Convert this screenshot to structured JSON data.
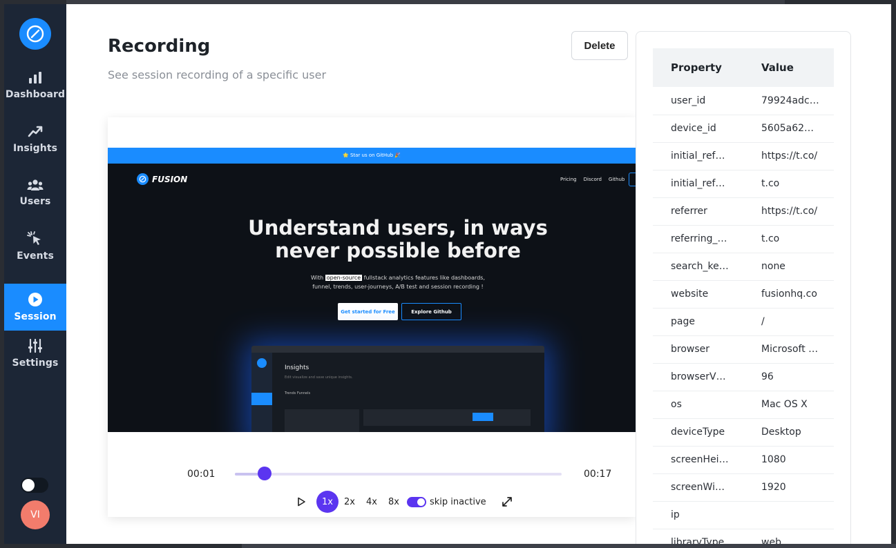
{
  "sidebar": {
    "items": [
      {
        "label": "Dashboard",
        "icon": "bar-chart-icon"
      },
      {
        "label": "Insights",
        "icon": "trend-up-icon"
      },
      {
        "label": "Users",
        "icon": "users-icon"
      },
      {
        "label": "Events",
        "icon": "cursor-click-icon"
      },
      {
        "label": "Session",
        "icon": "play-circle-icon",
        "active": true
      },
      {
        "label": "Settings",
        "icon": "sliders-icon"
      }
    ],
    "avatar_initials": "VI"
  },
  "header": {
    "title": "Recording",
    "subtitle": "See session recording of a specific user",
    "delete_label": "Delete"
  },
  "replay": {
    "banner": "🌟 Star us on GitHub 🎉",
    "site_name": "FUSION",
    "nav": [
      "Pricing",
      "Discord",
      "Github"
    ],
    "hero_line1": "Understand users, in ways",
    "hero_line2": "never possible before",
    "desc_prefix": "With ",
    "desc_highlight": "open-source",
    "desc_rest": " fullstack analytics features like dashboards,",
    "desc_line2": "funnel, trends, user-journeys, A/B test and session recording !",
    "cta_primary": "Get started for Free",
    "cta_secondary": "Explore Github",
    "mock_title": "Insights",
    "mock_subtitle": "Edit visualize and save unique insights.",
    "mock_tabs": "Trends     Funnels"
  },
  "player": {
    "current_time": "00:01",
    "total_time": "00:17",
    "progress": 0.09,
    "speeds": [
      "1x",
      "2x",
      "4x",
      "8x"
    ],
    "active_speed": "1x",
    "skip_label": "skip inactive",
    "skip_enabled": true
  },
  "properties": {
    "header_property": "Property",
    "header_value": "Value",
    "rows": [
      {
        "p": "user_id",
        "v": "79924adc…"
      },
      {
        "p": "device_id",
        "v": "5605a62…"
      },
      {
        "p": "initial_ref…",
        "v": "https://t.co/"
      },
      {
        "p": "initial_ref…",
        "v": "t.co"
      },
      {
        "p": "referrer",
        "v": "https://t.co/"
      },
      {
        "p": "referring_…",
        "v": "t.co"
      },
      {
        "p": "search_ke…",
        "v": "none"
      },
      {
        "p": "website",
        "v": "fusionhq.co"
      },
      {
        "p": "page",
        "v": "/"
      },
      {
        "p": "browser",
        "v": "Microsoft …"
      },
      {
        "p": "browserV…",
        "v": "96"
      },
      {
        "p": "os",
        "v": "Mac OS X"
      },
      {
        "p": "deviceType",
        "v": "Desktop"
      },
      {
        "p": "screenHei…",
        "v": "1080"
      },
      {
        "p": "screenWi…",
        "v": "1920"
      },
      {
        "p": "ip",
        "v": ""
      },
      {
        "p": "libraryType",
        "v": "web"
      }
    ]
  },
  "colors": {
    "sidebar_bg": "#1c2636",
    "accent": "#1a8cff",
    "player_accent": "#5b35f0",
    "avatar": "#f27c6c"
  }
}
